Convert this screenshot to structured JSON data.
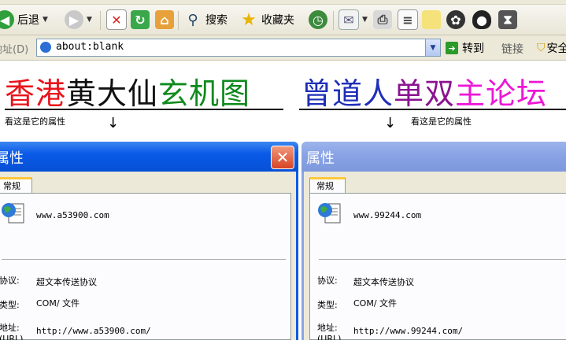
{
  "toolbar": {
    "back_label": "后退",
    "search_label": "搜索",
    "favorites_label": "收藏夹"
  },
  "address": {
    "label": "地址(D)",
    "url": "about:blank",
    "go_label": "转到",
    "links_label": "链接",
    "security_label": "安全"
  },
  "headlines": {
    "left": [
      {
        "text": "香港",
        "color": "#e8141c"
      },
      {
        "text": "黄大仙",
        "color": "#111111"
      },
      {
        "text": "玄机图",
        "color": "#0f8a1e"
      }
    ],
    "right": [
      {
        "text": "曾道人",
        "color": "#1f2fb8"
      },
      {
        "text": "单双",
        "color": "#8a1490"
      },
      {
        "text": "主论坛",
        "color": "#ec16d8"
      }
    ]
  },
  "hints": {
    "left": "看这是它的属性",
    "right": "看这是它的属性"
  },
  "dialogs": {
    "left": {
      "title": "属性",
      "tab": "常规",
      "name": "www.a53900.com",
      "protocol_label": "协议:",
      "protocol": "超文本传送协议",
      "type_label": "类型:",
      "type": "COM/ 文件",
      "address_label": "地址:",
      "address_label_sub": "(URL)",
      "address": "http://www.a53900.com/"
    },
    "right": {
      "title": "属性",
      "tab": "常规",
      "name": "www.99244.com",
      "protocol_label": "协议:",
      "protocol": "超文本传送协议",
      "type_label": "类型:",
      "type": "COM/ 文件",
      "address_label": "地址:",
      "address_label_sub": "(URL)",
      "address": "http://www.99244.com/"
    }
  },
  "colors": {
    "title_active": "#0a5ae8",
    "title_inactive": "#8aa4e6",
    "dialog_face": "#ece9d8"
  }
}
